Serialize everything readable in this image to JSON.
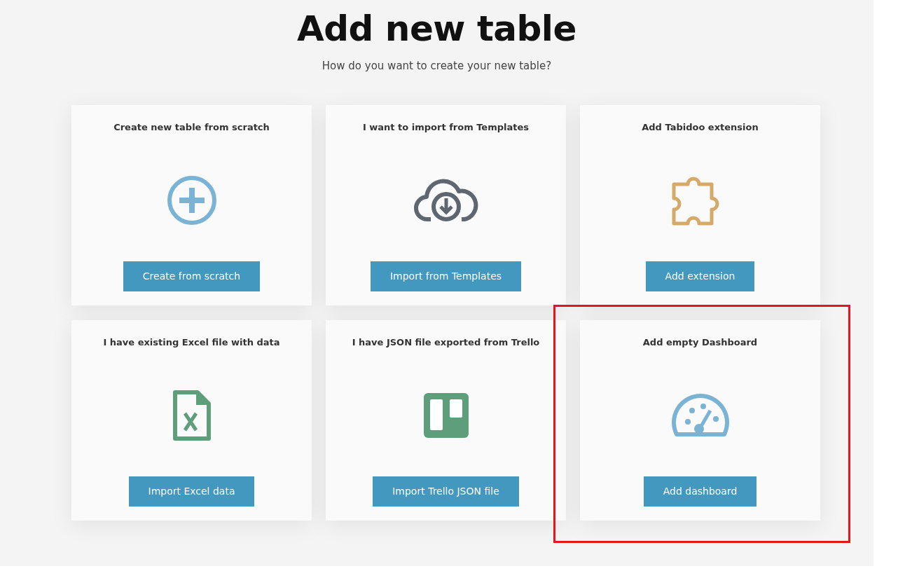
{
  "heading": "Add new table",
  "subtitle": "How do you want to create your new table?",
  "cards": [
    {
      "title": "Create new table from scratch",
      "kind": "plus",
      "button": "Create from scratch",
      "highlighted": false
    },
    {
      "title": "I want to import from Templates",
      "kind": "cloud",
      "button": "Import from Templates",
      "highlighted": false
    },
    {
      "title": "Add Tabidoo extension",
      "kind": "puzzle",
      "button": "Add extension",
      "highlighted": false
    },
    {
      "title": "I have existing Excel file with data",
      "kind": "excel",
      "button": "Import Excel data",
      "highlighted": false
    },
    {
      "title": "I have JSON file exported from Trello",
      "kind": "trello",
      "button": "Import Trello JSON file",
      "highlighted": false
    },
    {
      "title": "Add empty Dashboard",
      "kind": "gauge",
      "button": "Add dashboard",
      "highlighted": true
    }
  ]
}
